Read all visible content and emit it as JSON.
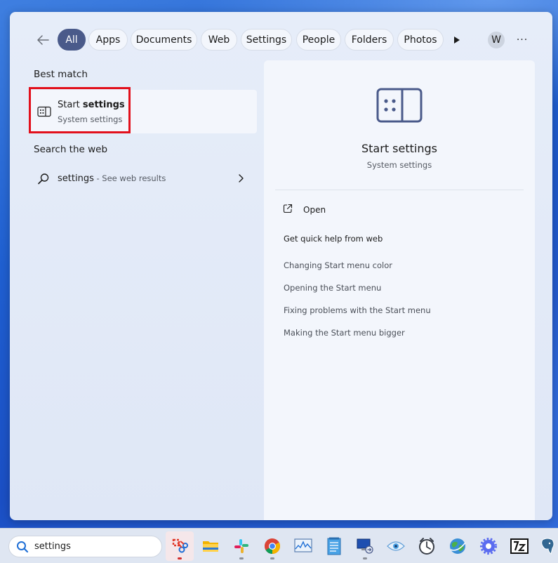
{
  "filters": {
    "chips": [
      "All",
      "Apps",
      "Documents",
      "Web",
      "Settings",
      "People",
      "Folders",
      "Photos"
    ],
    "active": "All",
    "avatar_initial": "W",
    "more_label": "···"
  },
  "results": {
    "best_match_heading": "Best match",
    "best_match": {
      "title_plain": "Start ",
      "title_bold": "settings",
      "subtitle": "System settings",
      "icon": "start-settings-icon"
    },
    "web_heading": "Search the web",
    "web_item": {
      "query": "settings",
      "suffix": " - See web results",
      "icon": "search-icon"
    }
  },
  "detail": {
    "title": "Start settings",
    "subtitle": "System settings",
    "open_label": "Open",
    "help_heading": "Get quick help from web",
    "help_links": [
      "Changing Start menu color",
      "Opening the Start menu",
      "Fixing problems with the Start menu",
      "Making the Start menu bigger"
    ]
  },
  "taskbar": {
    "search_value": "settings",
    "apps": [
      "snipping-tool-icon",
      "file-explorer-icon",
      "slack-icon",
      "chrome-icon",
      "resource-monitor-icon",
      "notepad-icon",
      "remote-desktop-icon",
      "eye-icon",
      "clock-icon",
      "globe-icon",
      "settings-gear-icon",
      "7zip-icon",
      "postgres-icon"
    ]
  },
  "colors": {
    "active_chip": "#4a5a8a",
    "highlight_box": "#e2101c",
    "panel": "#e4ebf8"
  }
}
